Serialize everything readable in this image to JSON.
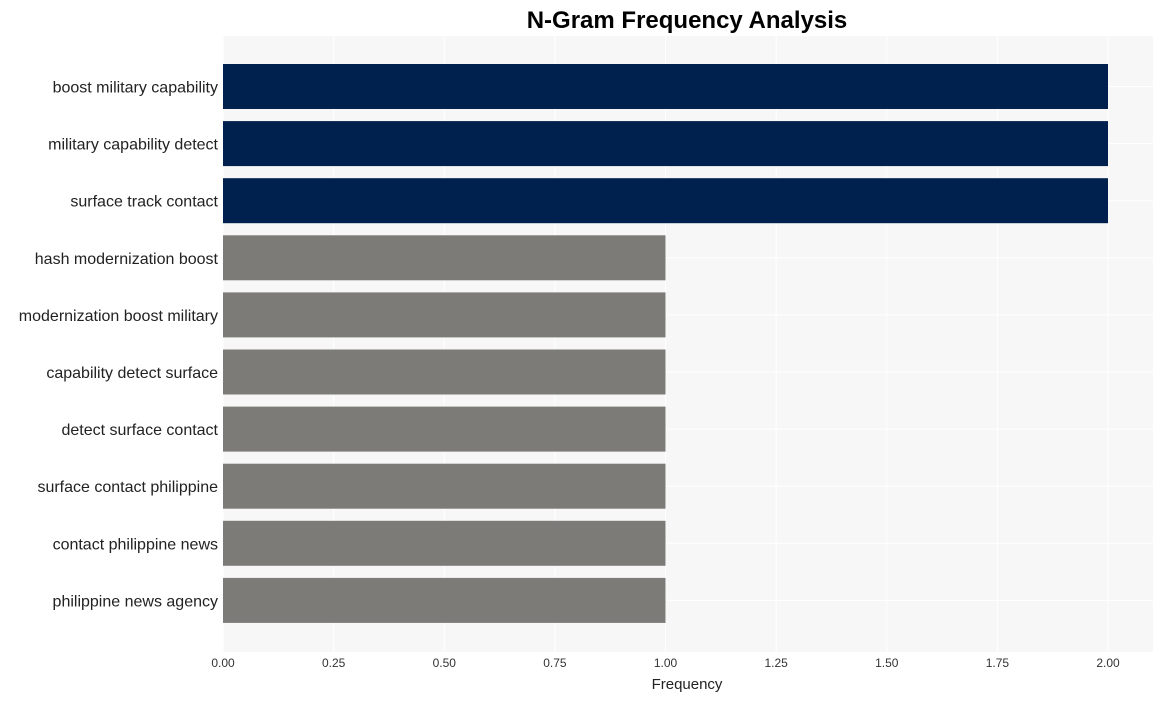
{
  "chart_data": {
    "type": "bar",
    "orientation": "horizontal",
    "title": "N-Gram Frequency Analysis",
    "xlabel": "Frequency",
    "ylabel": "",
    "xlim": [
      0,
      2.1
    ],
    "xticks": [
      "0.00",
      "0.25",
      "0.50",
      "0.75",
      "1.00",
      "1.25",
      "1.50",
      "1.75",
      "2.00"
    ],
    "xtick_values": [
      0,
      0.25,
      0.5,
      0.75,
      1.0,
      1.25,
      1.5,
      1.75,
      2.0
    ],
    "grid": true,
    "categories": [
      "boost military capability",
      "military capability detect",
      "surface track contact",
      "hash modernization boost",
      "modernization boost military",
      "capability detect surface",
      "detect surface contact",
      "surface contact philippine",
      "contact philippine news",
      "philippine news agency"
    ],
    "values": [
      2,
      2,
      2,
      1,
      1,
      1,
      1,
      1,
      1,
      1
    ],
    "colors": {
      "top": "#00214d",
      "other": "#7d7b77",
      "plot_background": "#f7f7f7",
      "grid": "#ffffff"
    }
  }
}
